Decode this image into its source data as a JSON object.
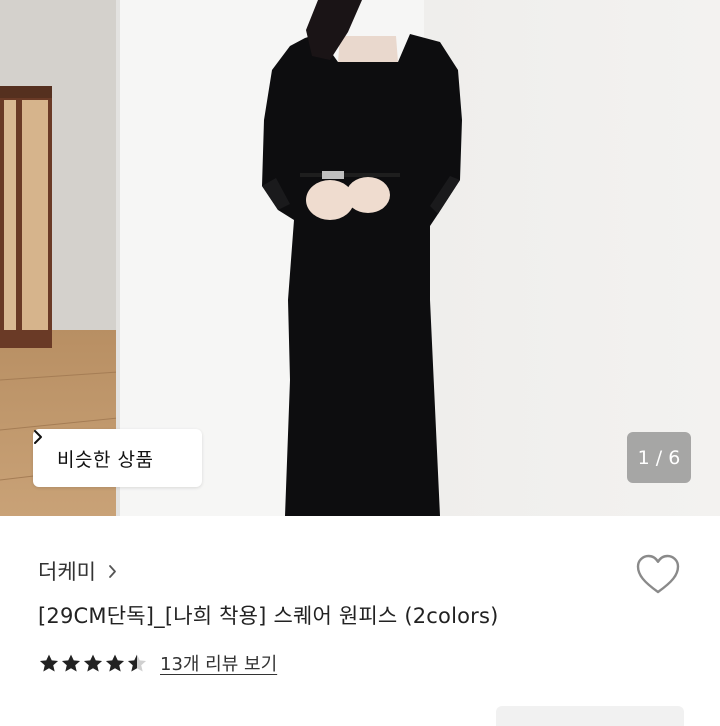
{
  "gallery": {
    "similar_button_label": "비슷한 상품",
    "page_counter": "1 / 6",
    "current_image": 1,
    "total_images": 6
  },
  "product": {
    "brand": "더케미",
    "title": "[29CM단독]_[나희 착용] 스퀘어 원피스 (2colors)",
    "rating": 4.5,
    "rating_max": 5,
    "review_link": "13개 리뷰 보기"
  },
  "icons": {
    "similar_chevron": "chevron-right-icon",
    "brand_chevron": "chevron-right-icon",
    "wishlist": "heart-outline-icon",
    "star": "star-icon"
  },
  "colors": {
    "text": "#222222",
    "star": "#222222",
    "counter_bg": "#7a7a7a"
  }
}
